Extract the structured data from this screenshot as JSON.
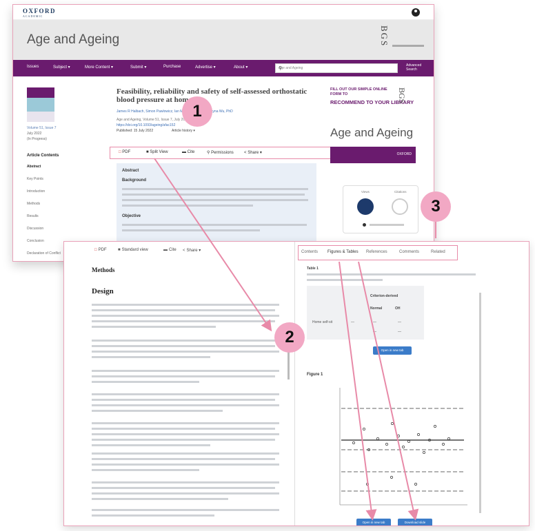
{
  "back": {
    "logo": "OXFORD",
    "logo_sub": "ACADEMIC",
    "journal_title": "Age and Ageing",
    "society": "BGS",
    "nav": [
      "Issues",
      "Subject ▾",
      "More Content ▾",
      "Submit ▾",
      "Purchase",
      "Advertise ▾",
      "About ▾"
    ],
    "search_placeholder": "Age and Ageing",
    "advanced_search": "Advanced Search",
    "side": {
      "issue": "Volume 51, Issue 7",
      "date": "July 2022",
      "pages": "(In Progress)",
      "contents_heading": "Article Contents",
      "links": [
        "Abstract",
        "Key Points",
        "Introduction",
        "Methods",
        "Results",
        "Discussion",
        "Conclusion",
        "Declaration of Conflict"
      ]
    },
    "article_title": "Feasibility, reliability and safety of self-assessed orthostatic blood pressure at home",
    "meta": {
      "authors": "James R Halbach, Simon Pawlowicz, Ian Mitchell, Kennedy, Jayna Wu, PhD",
      "journal": "Age and Ageing, Volume 51, Issue 7, July 2022, afac152,",
      "doi": "https://doi.org/10.1093/ageing/afac152",
      "published": "Published: 15 July 2022",
      "history": "Article history ▾"
    },
    "tools": [
      "PDF",
      "Split View",
      "Cite",
      "Permissions",
      "Share ▾"
    ],
    "abstract": {
      "heading": "Abstract",
      "background": "Background",
      "objective": "Objective"
    },
    "ad": {
      "fill": "FILL OUT OUR SIMPLE ONLINE FORM TO",
      "recommend": "RECOMMEND TO YOUR LIBRARY",
      "journal": "Age and Ageing",
      "oxford": "OXFORD"
    },
    "metrics": {
      "views": "Views",
      "citations": "Citations"
    }
  },
  "front": {
    "tools": [
      "PDF",
      "Standard view",
      "Cite",
      "Share ▾"
    ],
    "methods": "Methods",
    "design": "Design",
    "tabs": [
      "Contents",
      "Figures & Tables",
      "References",
      "Comments",
      "Related"
    ],
    "table": {
      "label": "Table 1",
      "col_group": "Criterion-derived",
      "col1": "Normal",
      "col2": "OH",
      "row1": "Home self-sit",
      "row2": "",
      "download": "Open in new tab"
    },
    "figure_label": "Figure 1",
    "fig_buttons": [
      "Open in new tab",
      "Download slide"
    ]
  },
  "callouts": [
    "1",
    "2",
    "3"
  ],
  "colors": {
    "purple": "#6a1b6e",
    "highlight_pink": "#e88aa8",
    "callout_pink": "#f2a8c4",
    "button_blue": "#3b7cc9",
    "abstract_bg": "#e9eff7"
  }
}
